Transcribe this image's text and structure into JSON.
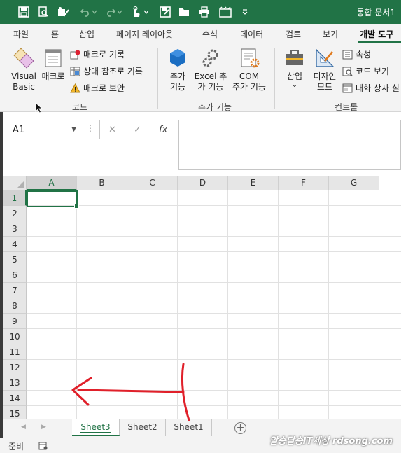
{
  "window": {
    "title": "통합 문서1"
  },
  "ribbon_tabs": [
    "파일",
    "홈",
    "삽입",
    "페이지 레이아웃",
    "수식",
    "데이터",
    "검토",
    "보기",
    "개발 도구"
  ],
  "active_tab": "개발 도구",
  "ribbon": {
    "code_group": {
      "label": "코드",
      "visual_basic": "Visual Basic",
      "visual_basic_line1": "Visual",
      "visual_basic_line2": "Basic",
      "macros": "매크로",
      "record_macro": "매크로 기록",
      "relative_refs": "상대 참조로 기록",
      "macro_security": "매크로 보안"
    },
    "addins_group": {
      "label": "추가 기능",
      "addins_line1": "추가",
      "addins_line2": "기능",
      "excel_addins_line1": "Excel 추",
      "excel_addins_line2": "가 기능",
      "com_addins_line1": "COM",
      "com_addins_line2": "추가 기능"
    },
    "controls_group": {
      "label": "컨트롤",
      "insert": "삽입",
      "insert_arrow": "⌄",
      "design_mode_line1": "디자인",
      "design_mode_line2": "모드",
      "properties": "속성",
      "view_code": "코드 보기",
      "run_dialog": "대화 상자 실"
    }
  },
  "formula_bar": {
    "name_box": "A1",
    "cancel_glyph": "✕",
    "enter_glyph": "✓",
    "fx_glyph": "fx",
    "formula": ""
  },
  "sheet": {
    "columns": [
      "A",
      "B",
      "C",
      "D",
      "E",
      "F",
      "G"
    ],
    "rows": [
      "1",
      "2",
      "3",
      "4",
      "5",
      "6",
      "7",
      "8",
      "9",
      "10",
      "11",
      "12",
      "13",
      "14",
      "15"
    ],
    "selected_cell": "A1"
  },
  "sheet_tabs": [
    "Sheet3",
    "Sheet2",
    "Sheet1"
  ],
  "active_sheet": "Sheet3",
  "add_sheet_glyph": "+",
  "status": {
    "mode": "준비"
  },
  "watermark": "알송달송IT세상 rdsong.com",
  "colors": {
    "accent": "#217346",
    "annotation": "#e0202a"
  }
}
